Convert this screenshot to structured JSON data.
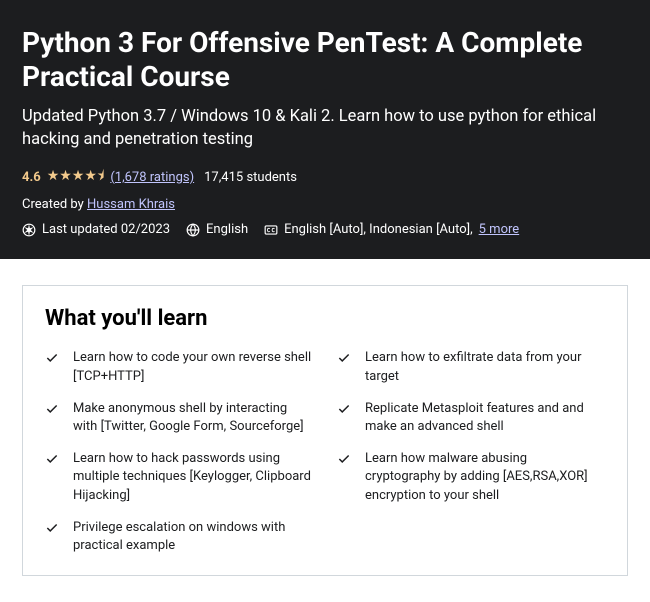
{
  "header": {
    "title": "Python 3 For Offensive PenTest: A Complete Practical Course",
    "subtitle": "Updated Python 3.7 / Windows 10 & Kali 2. Learn how to use python for ethical hacking and penetration testing",
    "rating": "4.6",
    "stars": "★★★★⯨",
    "ratings_link": "(1,678 ratings)",
    "students": "17,415 students",
    "created_by_label": "Created by ",
    "author": "Hussam Khrais",
    "last_updated": "Last updated 02/2023",
    "language": "English",
    "captions": "English [Auto], Indonesian [Auto], ",
    "more_link": "5 more"
  },
  "learn": {
    "title": "What you'll learn",
    "items": [
      "Learn how to code your own reverse shell [TCP+HTTP]",
      "Learn how to exfiltrate data from your target",
      "Make anonymous shell by interacting with [Twitter, Google Form, Sourceforge]",
      "Replicate Metasploit features and and make an advanced shell",
      "Learn how to hack passwords using multiple techniques [Keylogger, Clipboard Hijacking]",
      "Learn how malware abusing cryptography by adding [AES,RSA,XOR] encryption to your shell",
      "Privilege escalation on windows with practical example"
    ]
  }
}
